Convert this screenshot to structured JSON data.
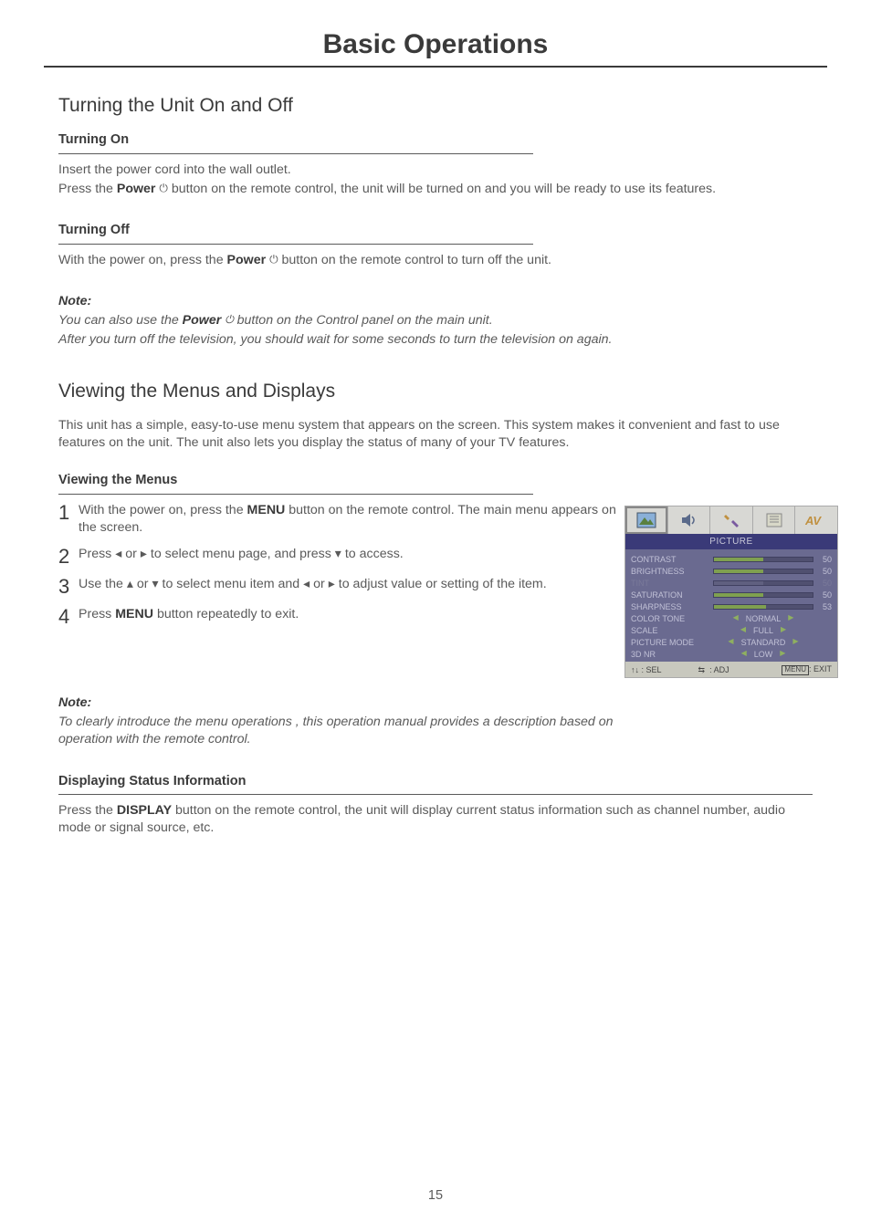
{
  "page_title": "Basic Operations",
  "section1": {
    "heading": "Turning the Unit On and Off",
    "on": {
      "title": "Turning On",
      "l1": "Insert the power cord into the wall outlet.",
      "l2a": "Press the ",
      "l2b": "Power",
      "l2c": " button on the remote control, the unit will be turned on and you will be ready to use its features."
    },
    "off": {
      "title": "Turning Off",
      "l1a": "With the power on, press the ",
      "l1b": "Power",
      "l1c": " button on the remote control to turn off the unit."
    },
    "note": {
      "title": "Note:",
      "l1a": "You can also use the ",
      "l1b": "Power",
      "l1c": " button on the Control panel on the main unit.",
      "l2": "After you turn off the television, you should wait for some seconds to turn the television on again."
    }
  },
  "section2": {
    "heading": "Viewing the Menus and Displays",
    "intro": "This unit has a simple, easy-to-use menu system that appears on the screen. This system makes it convenient and fast to use features on the unit. The unit also lets you display the status of many of your TV features.",
    "viewing": {
      "title": "Viewing the Menus",
      "s1a": "With the power on, press the ",
      "s1b": "MENU",
      "s1c": " button on the remote control. The main menu appears on the screen.",
      "s2a": "Press  ◂ or ▸ to select menu page, and press ▾ to access.",
      "s3a": "Use the  ▴ or  ▾  to select menu item and  ◂ or ▸  to adjust value or setting of the item.",
      "s4a": "Press ",
      "s4b": "MENU",
      "s4c": " button repeatedly to exit."
    },
    "note": {
      "title": "Note:",
      "body": "To clearly introduce the menu operations , this operation manual provides a description based on operation with the remote control."
    },
    "display": {
      "title": "Displaying Status Information",
      "l1a": "Press the ",
      "l1b": "DISPLAY",
      "l1c": " button on the remote control, the unit will display current status information such as channel number, audio mode or signal source, etc."
    }
  },
  "osd": {
    "title": "PICTURE",
    "rows": [
      {
        "label": "CONTRAST",
        "type": "bar",
        "fill": 50,
        "val": "50"
      },
      {
        "label": "BRIGHTNESS",
        "type": "bar",
        "fill": 50,
        "val": "50"
      },
      {
        "label": "TINT",
        "type": "bar",
        "fill": 50,
        "val": "50",
        "dim": true
      },
      {
        "label": "SATURATION",
        "type": "bar",
        "fill": 50,
        "val": "50"
      },
      {
        "label": "SHARPNESS",
        "type": "bar",
        "fill": 53,
        "val": "53"
      },
      {
        "label": "COLOR  TONE",
        "type": "sel",
        "val": "NORMAL"
      },
      {
        "label": "SCALE",
        "type": "sel",
        "val": "FULL"
      },
      {
        "label": "PICTURE  MODE",
        "type": "sel",
        "val": "STANDARD"
      },
      {
        "label": "3D NR",
        "type": "sel",
        "val": "LOW"
      }
    ],
    "footer": {
      "sel": ": SEL",
      "adj": ": ADJ",
      "exit": ": EXIT",
      "menu": "MENU"
    }
  },
  "page_num": "15",
  "chart_data": {
    "type": "table",
    "title": "PICTURE",
    "categories": [
      "CONTRAST",
      "BRIGHTNESS",
      "TINT",
      "SATURATION",
      "SHARPNESS",
      "COLOR TONE",
      "SCALE",
      "PICTURE MODE",
      "3D NR"
    ],
    "values": [
      50,
      50,
      50,
      50,
      53,
      "NORMAL",
      "FULL",
      "STANDARD",
      "LOW"
    ]
  }
}
